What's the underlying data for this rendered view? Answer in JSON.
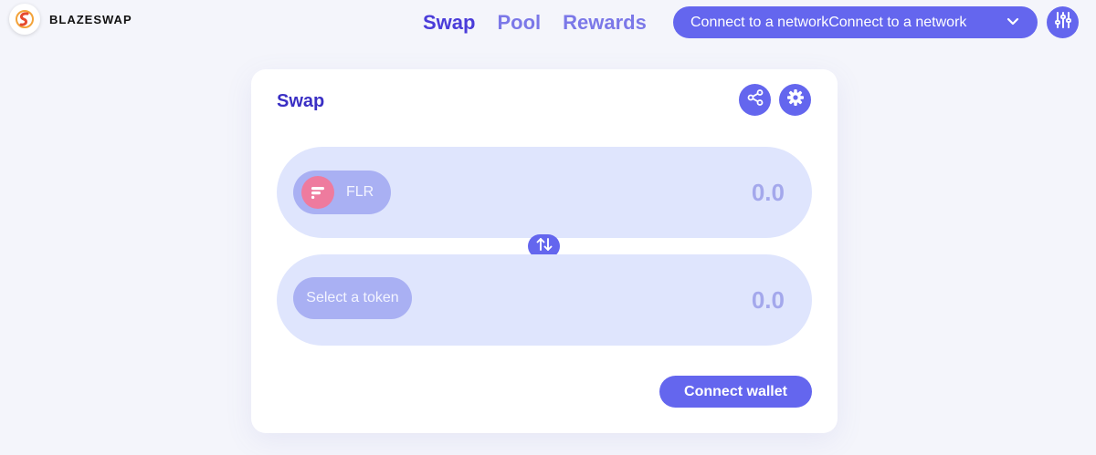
{
  "brand": {
    "name": "BLAZESWAP",
    "logo_icon": "blazeswap-logo-icon"
  },
  "nav": {
    "swap": "Swap",
    "pool": "Pool",
    "rewards": "Rewards"
  },
  "network_button": {
    "label": "Connect to a networkConnect to a network",
    "icon": "chevron-down-icon"
  },
  "top_settings": {
    "icon": "sliders-icon"
  },
  "card": {
    "title": "Swap",
    "share_icon": "share-icon",
    "settings_icon": "gear-icon",
    "from": {
      "token": "FLR",
      "token_icon": "flare-icon",
      "amount_placeholder": "0.0"
    },
    "to": {
      "token": "Select a token",
      "amount_placeholder": "0.0"
    },
    "switch_icon": "swap-arrows-icon",
    "connect_wallet": "Connect wallet"
  },
  "colors": {
    "accent": "#6466ee",
    "nav_active": "#4a3cd9",
    "nav_inactive": "#7b78e8",
    "row_bg": "#dfe5fd",
    "pill_bg": "#a9b0f3",
    "flr_pink": "#ee7b9e"
  }
}
